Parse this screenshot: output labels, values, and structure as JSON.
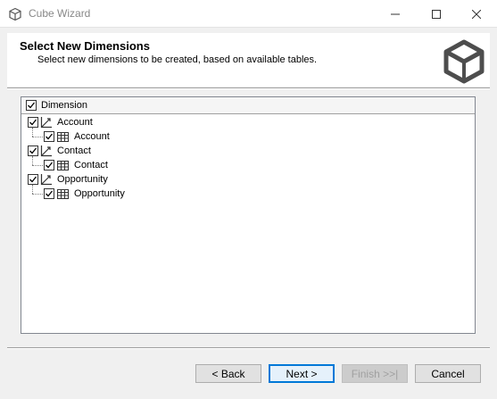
{
  "window": {
    "title": "Cube Wizard"
  },
  "header": {
    "title": "Select New Dimensions",
    "subtitle": "Select new dimensions to be created, based on available tables."
  },
  "tree": {
    "column_header": "Dimension",
    "items": [
      {
        "label": "Account",
        "checked": true,
        "child": {
          "label": "Account",
          "checked": true
        }
      },
      {
        "label": "Contact",
        "checked": true,
        "child": {
          "label": "Contact",
          "checked": true
        }
      },
      {
        "label": "Opportunity",
        "checked": true,
        "child": {
          "label": "Opportunity",
          "checked": true
        }
      }
    ]
  },
  "buttons": {
    "back": "< Back",
    "next": "Next >",
    "finish": "Finish >>|",
    "cancel": "Cancel"
  },
  "colors": {
    "accent": "#0078d7",
    "logo": "#4d4d4d"
  }
}
